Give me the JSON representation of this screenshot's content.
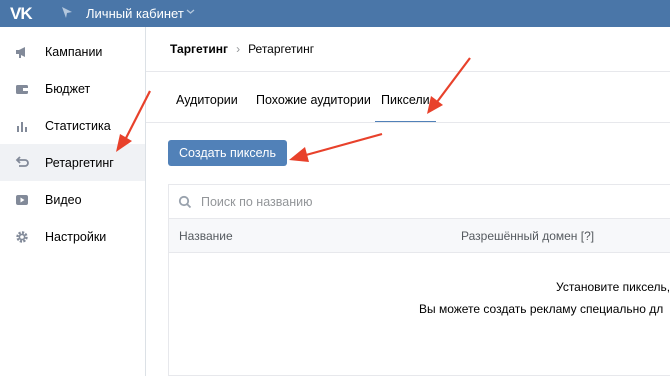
{
  "header": {
    "logo": "VK",
    "title": "Личный кабинет"
  },
  "sidebar": {
    "items": [
      {
        "label": "Кампании",
        "icon": "megaphone-icon"
      },
      {
        "label": "Бюджет",
        "icon": "wallet-icon"
      },
      {
        "label": "Статистика",
        "icon": "bar-chart-icon"
      },
      {
        "label": "Ретаргетинг",
        "icon": "retarget-icon",
        "active": true
      },
      {
        "label": "Видео",
        "icon": "play-icon"
      },
      {
        "label": "Настройки",
        "icon": "gear-icon"
      }
    ]
  },
  "breadcrumb": {
    "main": "Таргетинг",
    "separator": "›",
    "current": "Ретаргетинг"
  },
  "tabs": [
    {
      "label": "Аудитории"
    },
    {
      "label": "Похожие аудитории"
    },
    {
      "label": "Пиксели",
      "active": true
    }
  ],
  "create_button": "Создать пиксель",
  "search": {
    "placeholder": "Поиск по названию",
    "value": ""
  },
  "table": {
    "columns": [
      "Название",
      "Разрешённый домен [?]"
    ]
  },
  "empty_state": {
    "line1": "Установите пиксель, ч",
    "line2": "Вы можете создать рекламу специально дл"
  },
  "colors": {
    "header_bg": "#4a76a8",
    "accent": "#5181b8",
    "annotation_arrow": "#e8412b"
  }
}
